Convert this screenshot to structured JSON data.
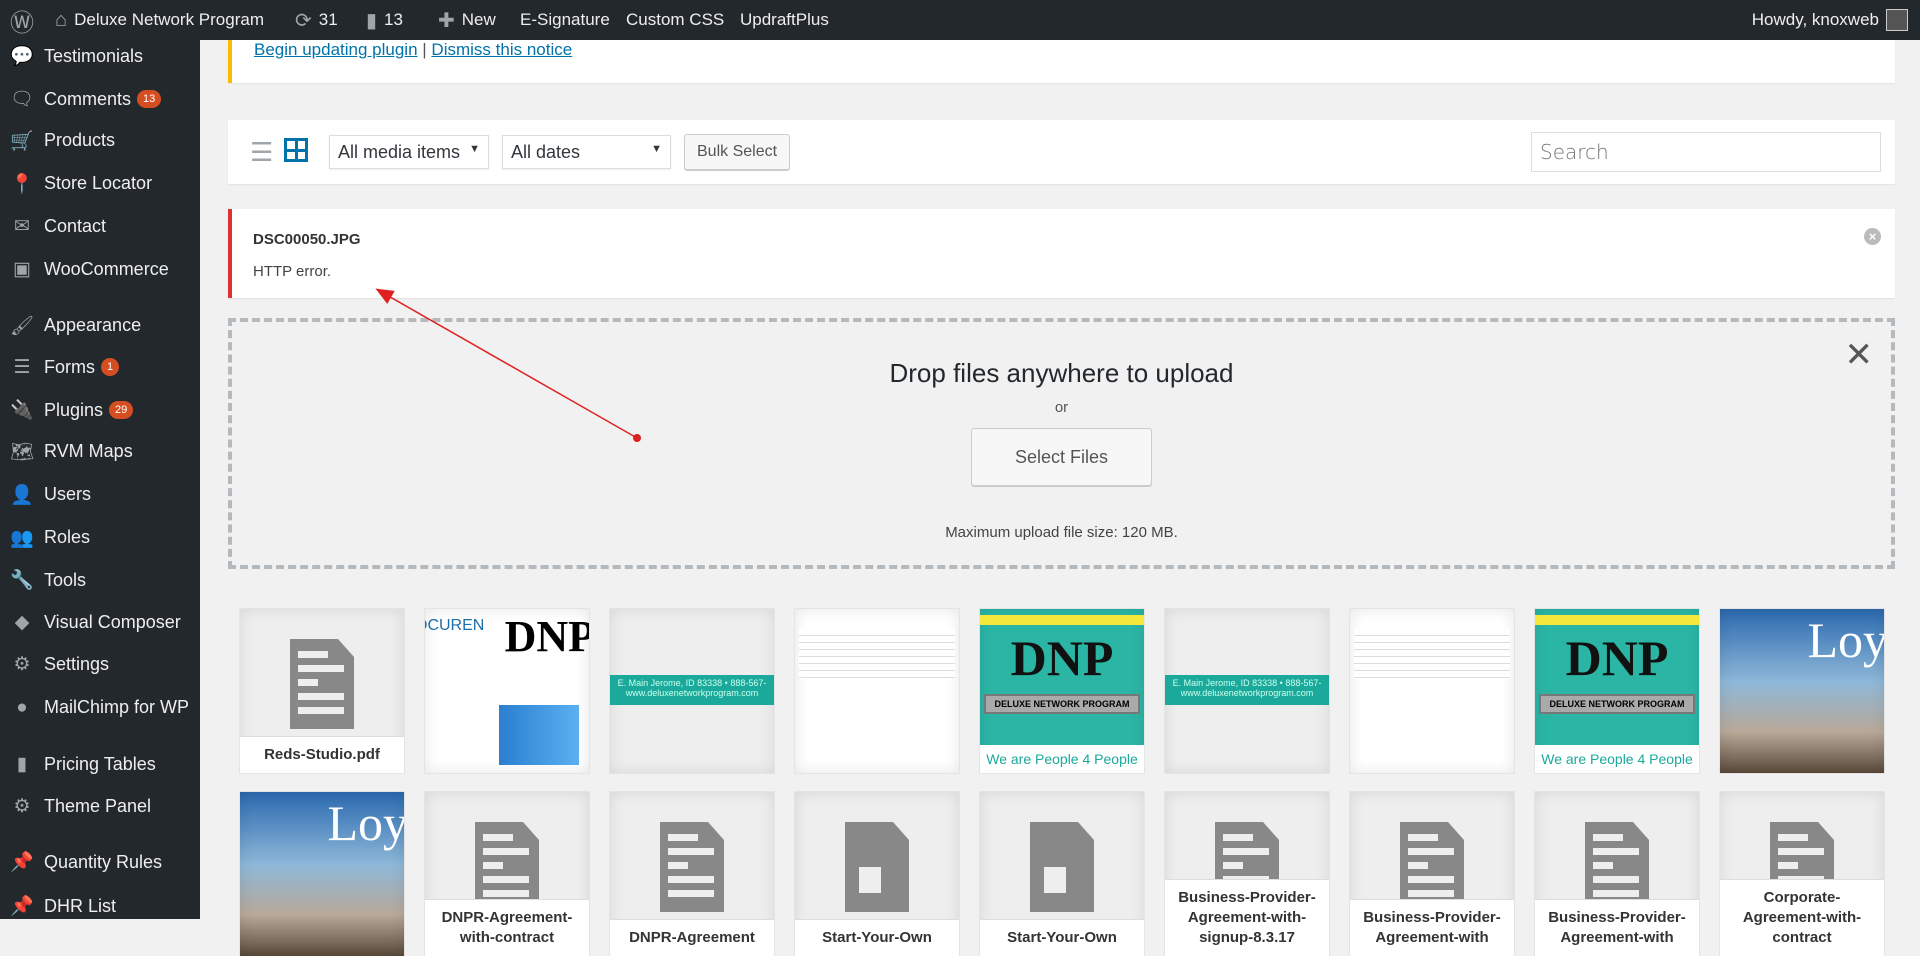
{
  "adminbar": {
    "site": "Deluxe Network Program",
    "updates": "31",
    "comments": "13",
    "new": "New",
    "links": [
      "E-Signature",
      "Custom CSS",
      "UpdraftPlus"
    ],
    "howdy": "Howdy, knoxweb"
  },
  "sidebar": [
    {
      "label": "Testimonials",
      "icon": "testimonial-icon",
      "glyph": "💬"
    },
    {
      "label": "Comments",
      "icon": "comments-icon",
      "glyph": "🗨",
      "badge": "13"
    },
    {
      "label": "Products",
      "icon": "cart-icon",
      "glyph": "🛒"
    },
    {
      "label": "Store Locator",
      "icon": "location-pin-icon",
      "glyph": "📍"
    },
    {
      "label": "Contact",
      "icon": "mail-icon",
      "glyph": "✉"
    },
    {
      "label": "WooCommerce",
      "icon": "woocommerce-icon",
      "glyph": "▣"
    },
    {
      "label": "Appearance",
      "icon": "paintbrush-icon",
      "glyph": "🖌"
    },
    {
      "label": "Forms",
      "icon": "forms-icon",
      "glyph": "☰",
      "badge": "1"
    },
    {
      "label": "Plugins",
      "icon": "plugin-icon",
      "glyph": "🔌",
      "badge": "29"
    },
    {
      "label": "RVM Maps",
      "icon": "map-icon",
      "glyph": "🗺"
    },
    {
      "label": "Users",
      "icon": "user-icon",
      "glyph": "👤"
    },
    {
      "label": "Roles",
      "icon": "roles-icon",
      "glyph": "👥"
    },
    {
      "label": "Tools",
      "icon": "wrench-icon",
      "glyph": "🔧"
    },
    {
      "label": "Visual Composer",
      "icon": "visual-composer-icon",
      "glyph": "◆"
    },
    {
      "label": "Settings",
      "icon": "settings-icon",
      "glyph": "⚙"
    },
    {
      "label": "MailChimp for WP",
      "icon": "mailchimp-icon",
      "glyph": "●"
    },
    {
      "label": "Pricing Tables",
      "icon": "chart-bars-icon",
      "glyph": "▮"
    },
    {
      "label": "Theme Panel",
      "icon": "gear-icon",
      "glyph": "⚙"
    },
    {
      "label": "Quantity Rules",
      "icon": "pin-icon",
      "glyph": "📌"
    },
    {
      "label": "DHR List",
      "icon": "pin-icon",
      "glyph": "📌"
    }
  ],
  "notice": {
    "begin": "Begin updating plugin",
    "sep": "|",
    "dismiss": "Dismiss this notice"
  },
  "toolbar": {
    "type_filter": "All media items",
    "date_filter": "All dates",
    "bulk": "Bulk Select",
    "search_placeholder": "Search"
  },
  "error": {
    "file": "DSC00050.JPG",
    "message": "HTTP error."
  },
  "uploader": {
    "title": "Drop files anywhere to upload",
    "or": "or",
    "button": "Select Files",
    "max": "Maximum upload file size: 120 MB."
  },
  "colors": {
    "adminbar": "#23282d",
    "link": "#0073aa",
    "error": "#dc3232",
    "badge": "#d54e21",
    "teal": "#1aa99a"
  },
  "tiles": [
    {
      "type": "doc",
      "label": "Reds-Studio.pdf"
    },
    {
      "type": "ad",
      "text": "OCUREN",
      "sub": "DNP"
    },
    {
      "type": "strip",
      "text": "E. Main Jerome, ID 83338 • 888-567-",
      "sub": "www.deluxenetworkprogram.com"
    },
    {
      "type": "letter"
    },
    {
      "type": "dnp",
      "text": "DNP",
      "sub": "DELUXE NETWORK PROGRAM",
      "tag": "We are People 4 People"
    },
    {
      "type": "strip",
      "text": "E. Main Jerome, ID 83338 • 888-567-",
      "sub": "www.deluxenetworkprogram.com"
    },
    {
      "type": "letter"
    },
    {
      "type": "dnp",
      "text": "DNP",
      "sub": "DELUXE NETWORK PROGRAM",
      "tag": "We are People 4 People"
    },
    {
      "type": "photo",
      "text": "Loy"
    },
    {
      "type": "photo",
      "text": "Loy"
    },
    {
      "type": "doc",
      "label": "DNPR-Agreement-with-contract"
    },
    {
      "type": "doc",
      "label": "DNPR-Agreement"
    },
    {
      "type": "video",
      "label": "Start-Your-Own"
    },
    {
      "type": "video",
      "label": "Start-Your-Own"
    },
    {
      "type": "doc",
      "label": "Business-Provider-Agreement-with-signup-8.3.17"
    },
    {
      "type": "doc",
      "label": "Business-Provider-Agreement-with"
    },
    {
      "type": "doc",
      "label": "Business-Provider-Agreement-with"
    },
    {
      "type": "doc",
      "label": "Corporate-Agreement-with-contract"
    }
  ]
}
